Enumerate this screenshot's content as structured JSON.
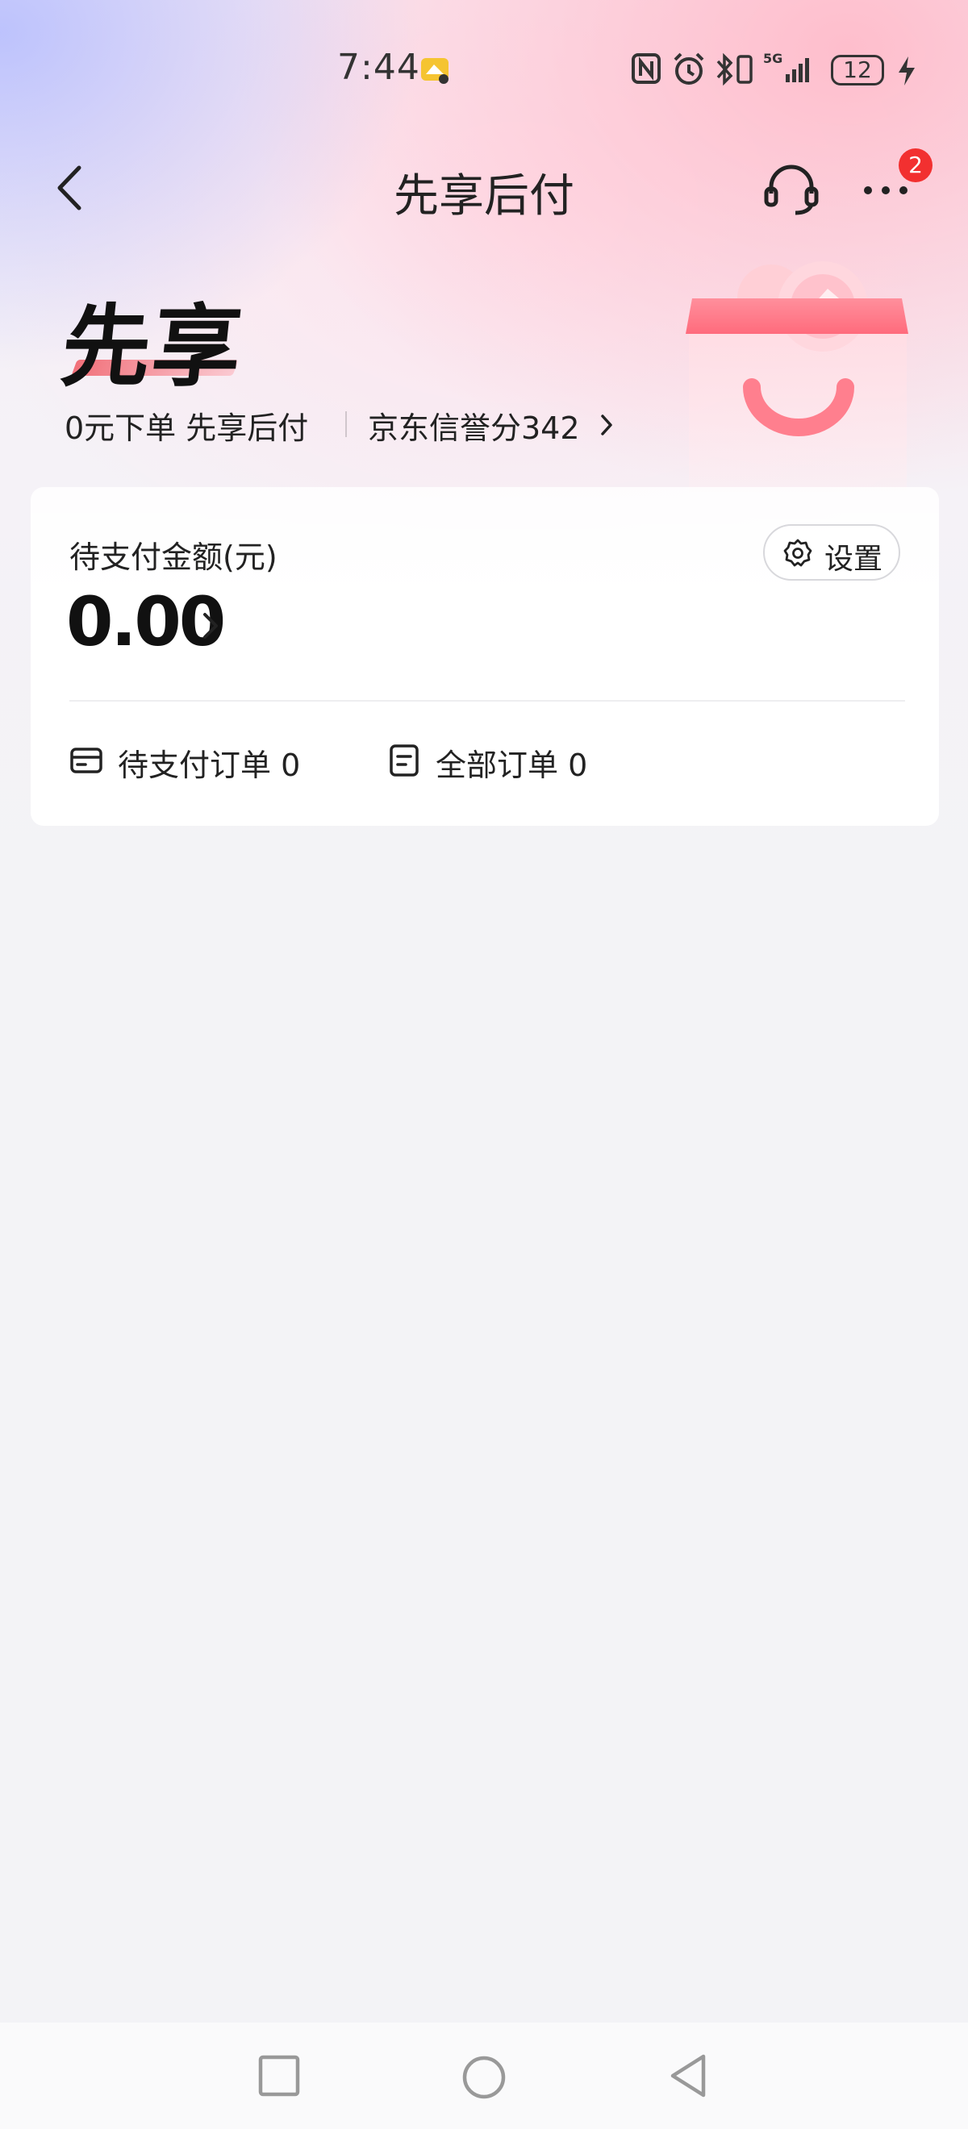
{
  "status_bar": {
    "time": "7:44",
    "battery_level": "12",
    "icons": [
      "nfc-icon",
      "alarm-icon",
      "bluetooth-icon",
      "5g-signal-icon",
      "battery-icon",
      "charging-icon"
    ]
  },
  "nav": {
    "title": "先享后付",
    "badge_count": "2",
    "icons": [
      "back-icon",
      "customer-service-icon",
      "more-icon"
    ]
  },
  "hero": {
    "title": "先享",
    "subtitle": "0元下单 先享后付",
    "credit_text": "京东信誉分342"
  },
  "card": {
    "amount_label": "待支付金额(元)",
    "amount": "0.00",
    "settings_label": "设置",
    "pending_orders_label": "待支付订单 0",
    "all_orders_label": "全部订单 0"
  },
  "colors": {
    "accent_red": "#f23030",
    "background": "#f3f3f6",
    "card": "#ffffff"
  }
}
